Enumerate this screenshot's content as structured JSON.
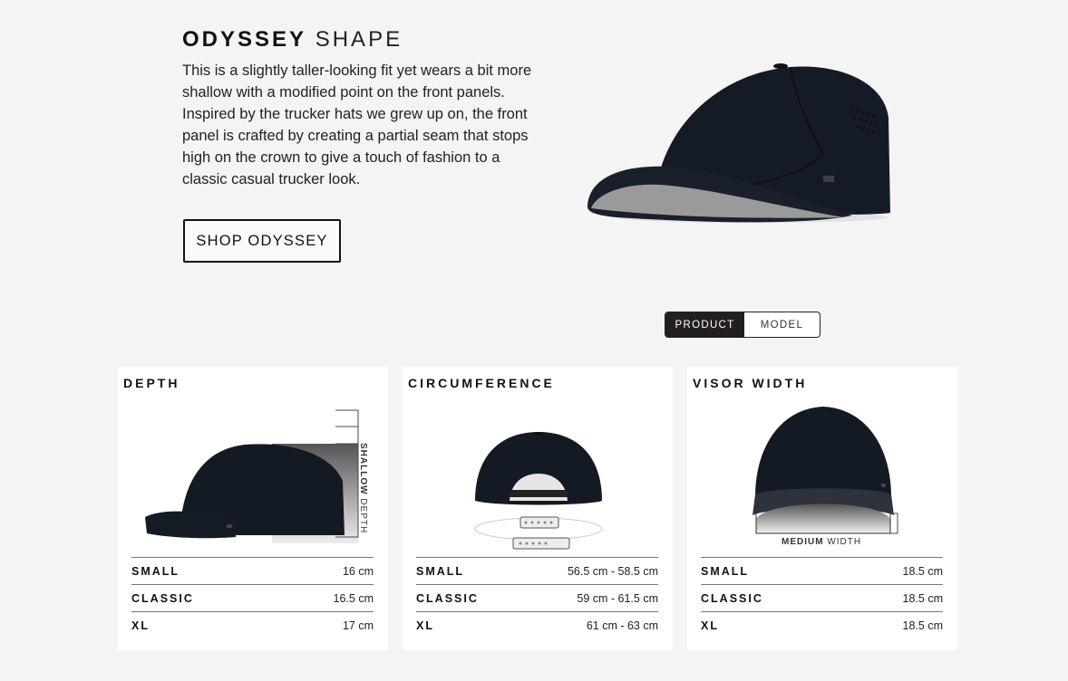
{
  "header": {
    "title_bold": "ODYSSEY",
    "title_light": "SHAPE",
    "description": "This is a slightly taller-looking fit yet wears a bit more shallow with a modified point on the front panels. Inspired by the trucker hats we grew up on, the front panel is crafted by creating a partial seam that stops high on the crown to give a touch of fashion to a classic casual trucker look.",
    "shop_button": "SHOP ODYSSEY"
  },
  "view_toggle": {
    "options": [
      "PRODUCT",
      "MODEL"
    ],
    "selected": "PRODUCT"
  },
  "cards": [
    {
      "title": "DEPTH",
      "image_caption_bold": "SHALLOW",
      "image_caption_rest": " DEPTH",
      "rows": [
        {
          "size": "SMALL",
          "value": "16 cm"
        },
        {
          "size": "CLASSIC",
          "value": "16.5 cm"
        },
        {
          "size": "XL",
          "value": "17 cm"
        }
      ]
    },
    {
      "title": "CIRCUMFERENCE",
      "rows": [
        {
          "size": "SMALL",
          "value": "56.5 cm - 58.5 cm"
        },
        {
          "size": "CLASSIC",
          "value": "59 cm - 61.5 cm"
        },
        {
          "size": "XL",
          "value": "61 cm - 63 cm"
        }
      ]
    },
    {
      "title": "VISOR WIDTH",
      "image_caption_bold": "MEDIUM",
      "image_caption_rest": " WIDTH",
      "rows": [
        {
          "size": "SMALL",
          "value": "18.5 cm"
        },
        {
          "size": "CLASSIC",
          "value": "18.5 cm"
        },
        {
          "size": "XL",
          "value": "18.5 cm"
        }
      ]
    }
  ]
}
